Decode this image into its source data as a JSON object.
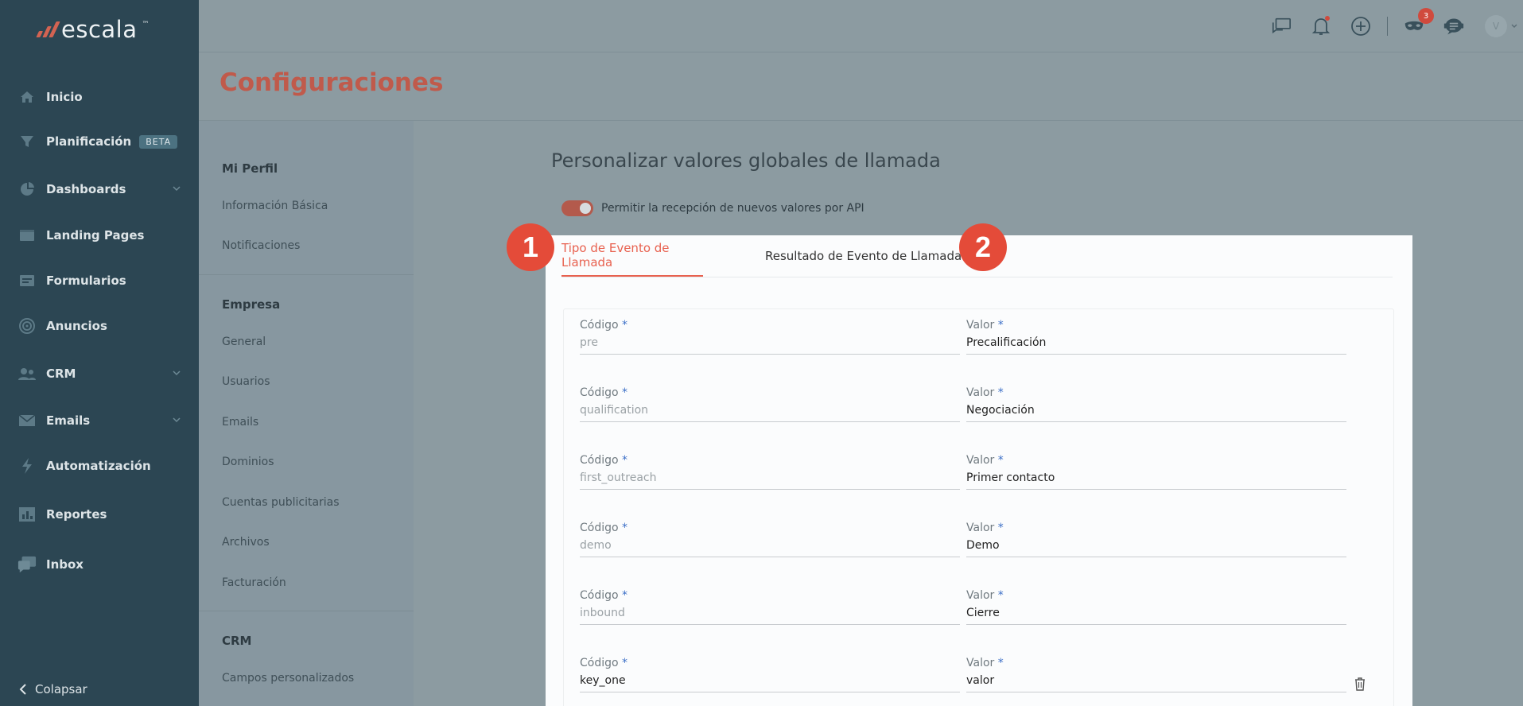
{
  "app": {
    "logo_text": "escala",
    "logo_tm": "™"
  },
  "sidebar": {
    "items": [
      {
        "label": "Inicio",
        "icon": "home-icon"
      },
      {
        "label": "Planificación",
        "icon": "funnel-icon",
        "badge": "BETA"
      },
      {
        "label": "Dashboards",
        "icon": "pie-chart-icon",
        "has_chevron": true
      },
      {
        "label": "Landing Pages",
        "icon": "browser-icon"
      },
      {
        "label": "Formularios",
        "icon": "form-icon"
      },
      {
        "label": "Anuncios",
        "icon": "target-icon"
      },
      {
        "label": "CRM",
        "icon": "users-icon",
        "has_chevron": true
      },
      {
        "label": "Emails",
        "icon": "envelope-icon",
        "has_chevron": true
      },
      {
        "label": "Automatización",
        "icon": "lightning-icon"
      },
      {
        "label": "Reportes",
        "icon": "report-icon"
      },
      {
        "label": "Inbox",
        "icon": "chat-icon"
      }
    ],
    "collapse_label": "Colapsar"
  },
  "topbar": {
    "notification_badge": "3",
    "avatar_initial": "V",
    "icons": [
      "conversations-icon",
      "bell-icon",
      "plus-circle-icon",
      "mask-icon",
      "support-chat-icon"
    ]
  },
  "page": {
    "title": "Configuraciones"
  },
  "settings_nav": {
    "sections": [
      {
        "heading": "Mi Perfil",
        "links": [
          "Información Básica",
          "Notificaciones"
        ]
      },
      {
        "heading": "Empresa",
        "links": [
          "General",
          "Usuarios",
          "Emails",
          "Dominios",
          "Cuentas publicitarias",
          "Archivos",
          "Facturación"
        ]
      },
      {
        "heading": "CRM",
        "links": [
          "Campos personalizados"
        ]
      }
    ]
  },
  "main": {
    "title": "Personalizar valores globales de llamada",
    "toggle_label": "Permitir la recepción de nuevos valores por API",
    "toggle_on": true,
    "tabs": [
      {
        "label": "Tipo de Evento de Llamada",
        "active": true
      },
      {
        "label": "Resultado de Evento de Llamada",
        "active": false
      }
    ],
    "code_label": "Código",
    "value_label": "Valor",
    "required_mark": "*",
    "rows": [
      {
        "code": "pre",
        "code_filled": false,
        "value": "Precalificación"
      },
      {
        "code": "qualification",
        "code_filled": false,
        "value": "Negociación"
      },
      {
        "code": "first_outreach",
        "code_filled": false,
        "value": "Primer contacto"
      },
      {
        "code": "demo",
        "code_filled": false,
        "value": "Demo"
      },
      {
        "code": "inbound",
        "code_filled": false,
        "value": "Cierre"
      },
      {
        "code": "key_one",
        "code_filled": true,
        "value": "valor",
        "deletable": true
      }
    ]
  },
  "annotations": [
    "1",
    "2"
  ],
  "colors": {
    "accent": "#e8614f",
    "sidebar": "#2c4653",
    "badge": "#e44b39"
  }
}
